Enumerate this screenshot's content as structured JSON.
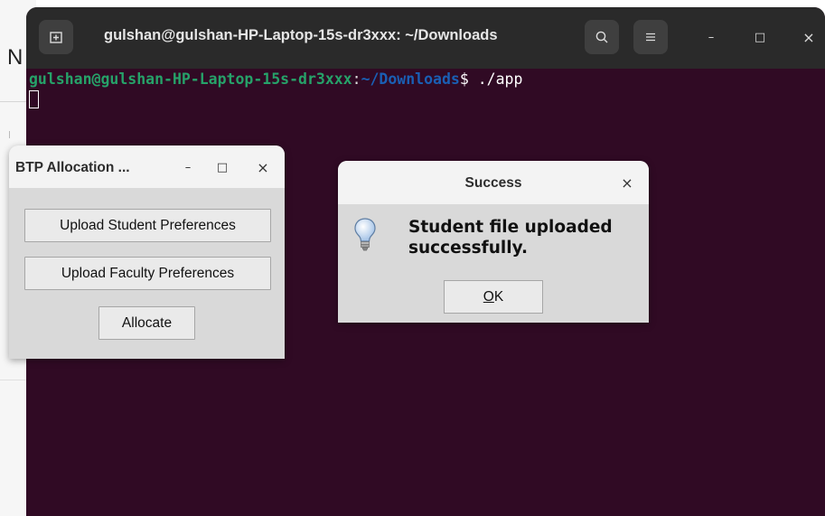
{
  "terminal": {
    "title": "gulshan@gulshan-HP-Laptop-15s-dr3xxx: ~/Downloads",
    "prompt_user": "gulshan@gulshan-HP-Laptop-15s-dr3xxx",
    "prompt_colon": ":",
    "prompt_path": "~/Downloads",
    "prompt_symbol": "$ ",
    "command": "./app",
    "new_tab_icon": "new-tab-icon",
    "search_icon": "search-icon",
    "menu_icon": "hamburger-menu-icon",
    "minimize": "–",
    "maximize": "□",
    "close": "×"
  },
  "background": {
    "partial_letter": "N"
  },
  "btp_window": {
    "title": "BTP Allocation ...",
    "minimize": "–",
    "maximize": "□",
    "close": "×",
    "buttons": {
      "upload_student": "Upload Student Preferences",
      "upload_faculty": "Upload Faculty Preferences",
      "allocate": "Allocate"
    }
  },
  "success_dialog": {
    "title": "Success",
    "close": "×",
    "message": "Student file uploaded successfully.",
    "icon": "lightbulb-info-icon",
    "ok_underlined": "O",
    "ok_rest": "K"
  },
  "colors": {
    "terminal_bg": "#300a24",
    "prompt_user": "#26a269",
    "prompt_path": "#1a5fb4",
    "header_bg": "#2a2a2a",
    "dialog_bg": "#d9d9d9"
  }
}
